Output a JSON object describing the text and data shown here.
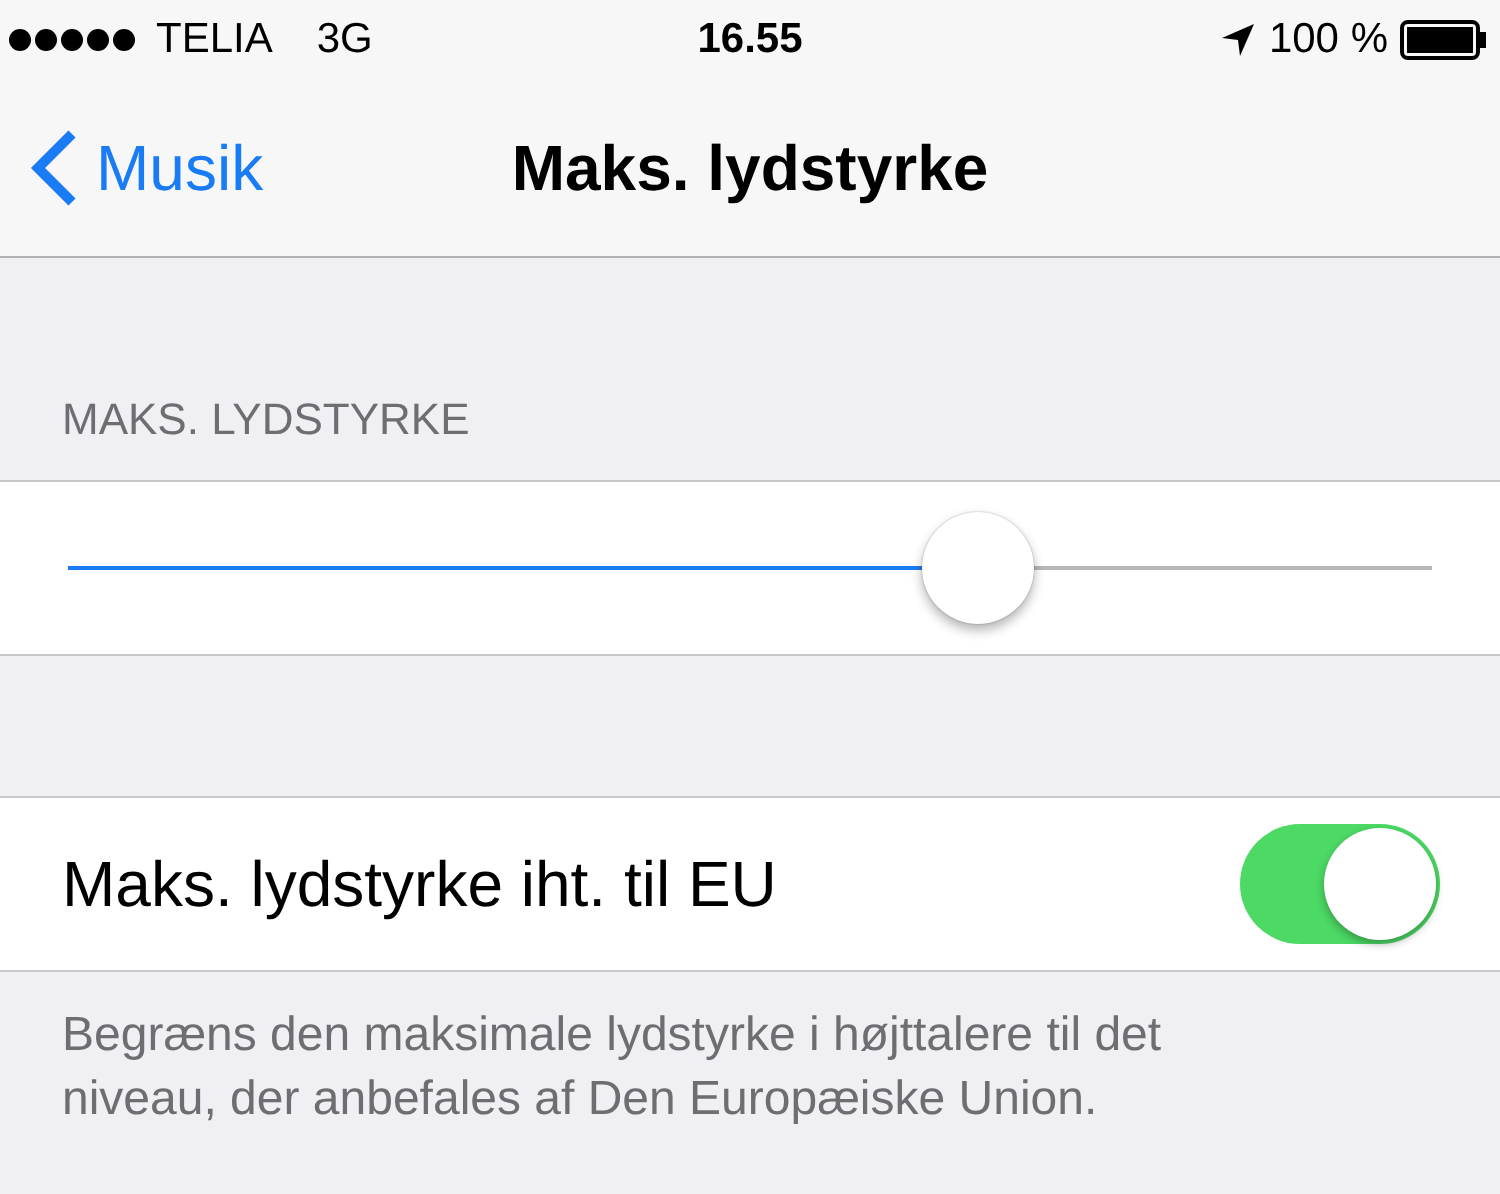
{
  "status_bar": {
    "carrier": "TELIA",
    "network": "3G",
    "time": "16.55",
    "battery": "100 %"
  },
  "nav": {
    "back": "Musik",
    "title": "Maks. lydstyrke"
  },
  "section_header": "MAKS. LYDSTYRKE",
  "slider": {
    "level": 0.667
  },
  "toggle": {
    "label": "Maks. lydstyrke iht. til EU",
    "on": true
  },
  "footer": "Begræns den maksimale lydstyrke i højttalere til det niveau, der anbefales af Den Europæiske Union."
}
